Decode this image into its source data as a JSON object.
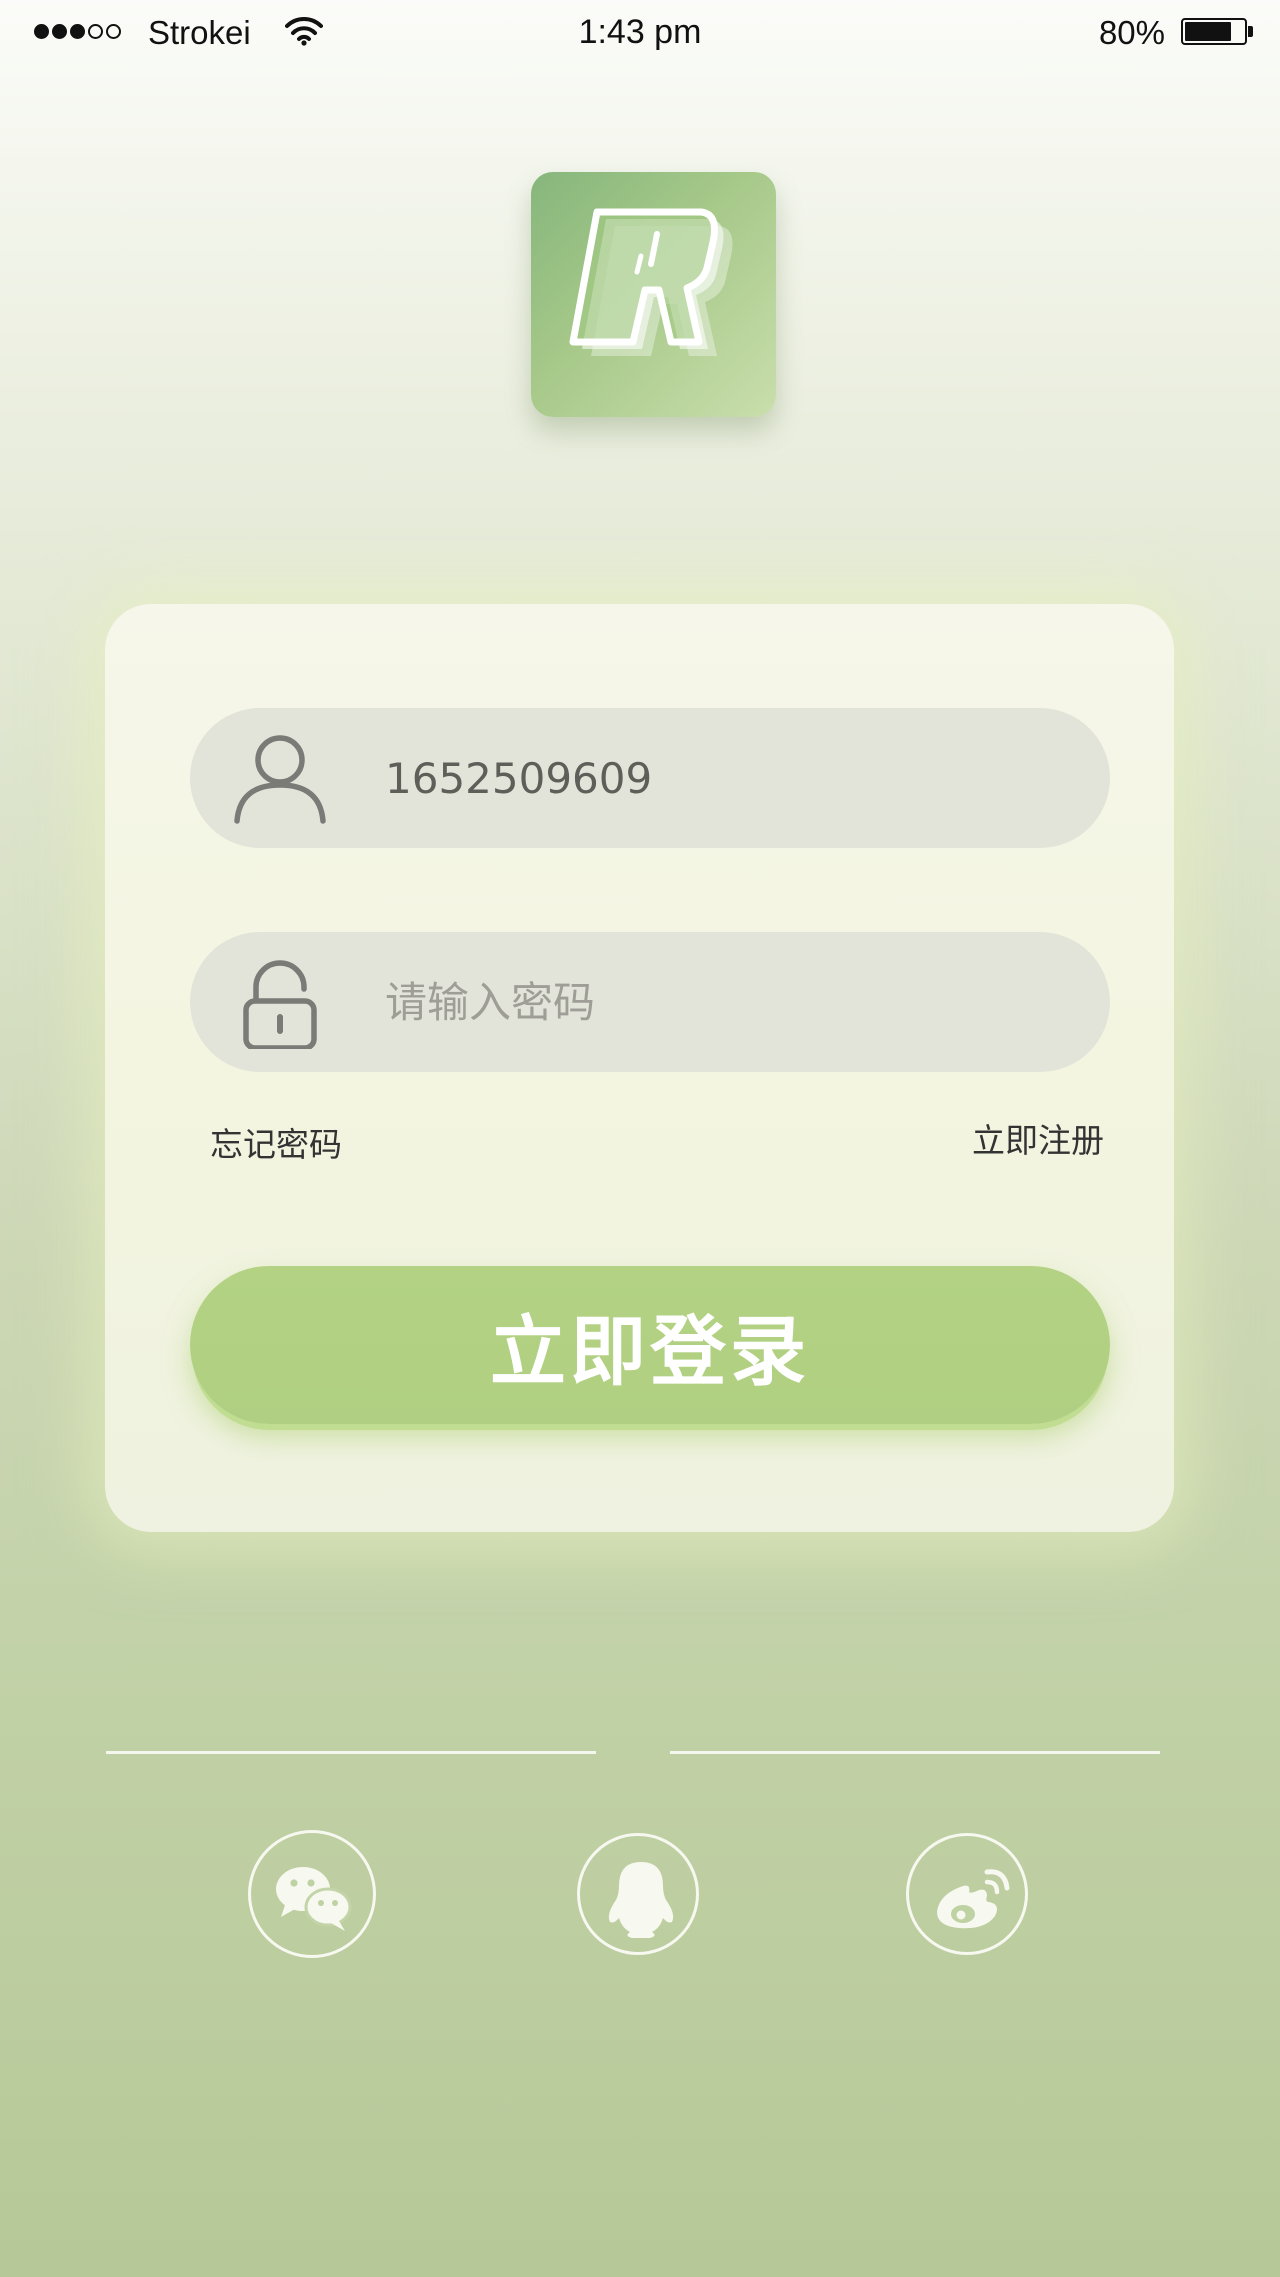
{
  "status_bar": {
    "carrier": "Strokei",
    "time": "1:43 pm",
    "battery": "80%",
    "battery_level": 0.8,
    "signal_strength": 3,
    "signal_max": 5
  },
  "logo": {
    "icon": "app-logo-r-icon"
  },
  "login_form": {
    "username": {
      "icon": "user-icon",
      "value": "1652509609"
    },
    "password": {
      "icon": "lock-icon",
      "value": "",
      "placeholder": "请输入密码"
    },
    "forgot_password": "忘记密码",
    "register": "立即注册",
    "login_button": "立即登录"
  },
  "social_login": [
    {
      "name": "wechat",
      "icon": "wechat-icon"
    },
    {
      "name": "qq",
      "icon": "qq-icon"
    },
    {
      "name": "weibo",
      "icon": "weibo-icon"
    }
  ],
  "colors": {
    "accent": "#b2d183",
    "card_background": "#f3f5e0",
    "input_background": "#e3e4d9",
    "icon_gray": "#7a7a77"
  }
}
